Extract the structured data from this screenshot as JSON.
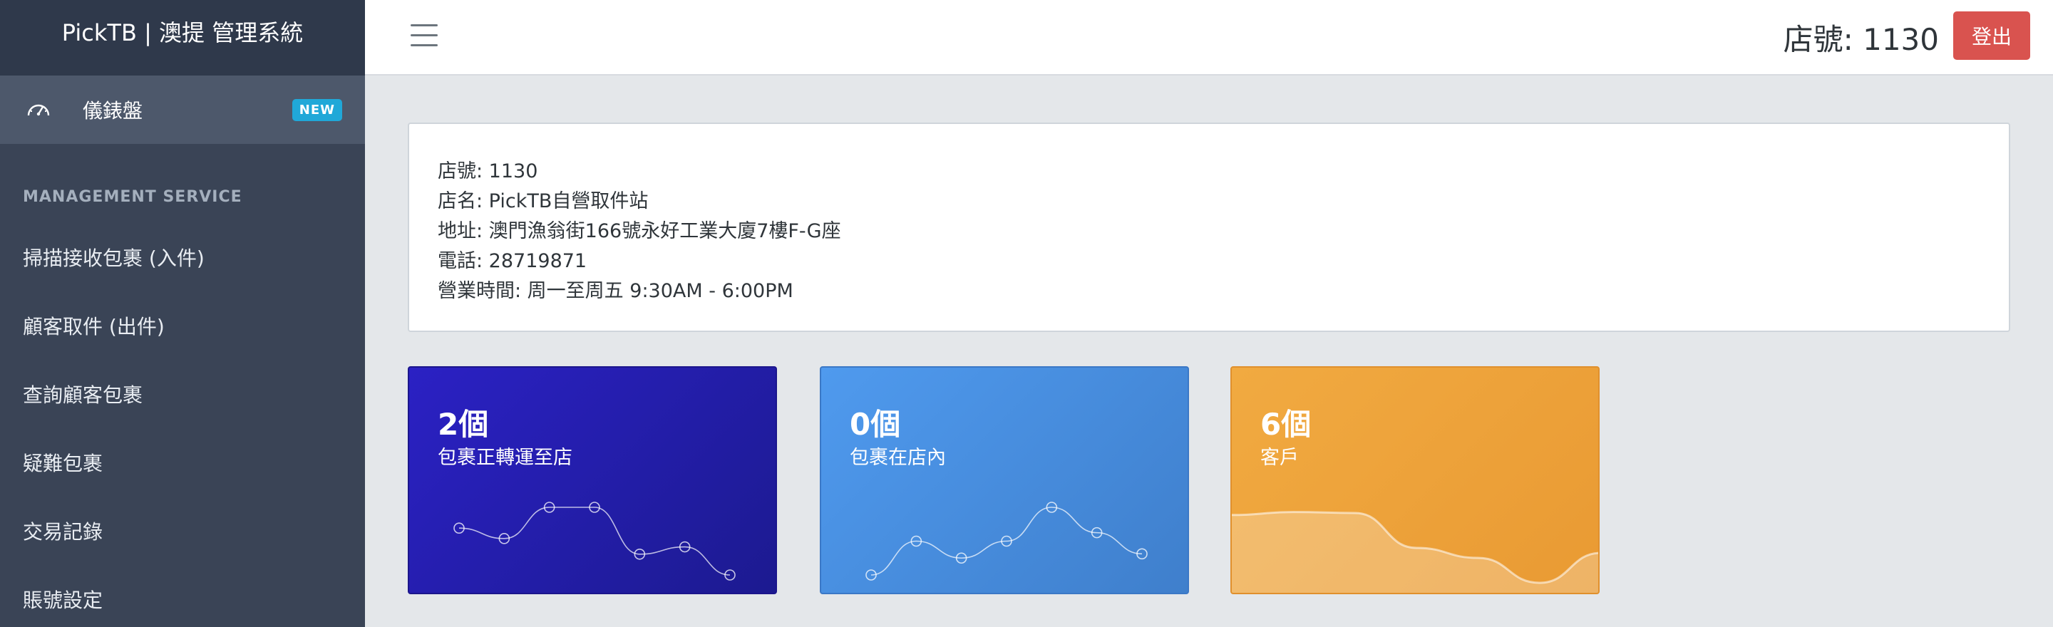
{
  "app": {
    "brand": "PickTB | 澳提 管理系統"
  },
  "sidebar": {
    "dashboard": {
      "label": "儀錶盤",
      "badge": "NEW",
      "icon": "speedometer-icon"
    },
    "section_title": "MANAGEMENT SERVICE",
    "items": [
      {
        "label": "掃描接收包裹 (入件)"
      },
      {
        "label": "顧客取件 (出件)"
      },
      {
        "label": "查詢顧客包裹"
      },
      {
        "label": "疑難包裹"
      },
      {
        "label": "交易記錄"
      },
      {
        "label": "賬號設定"
      }
    ]
  },
  "header": {
    "menu_icon": "hamburger-icon",
    "shop_number": "店號: 1130",
    "logout_label": "登出"
  },
  "info": {
    "lines": [
      "店號: 1130",
      "店名: PickTB自營取件站",
      "地址: 澳門漁翁街166號永好工業大廈7樓F-G座",
      "電話: 28719871",
      "營業時間: 周一至周五 9:30AM - 6:00PM"
    ]
  },
  "stats": [
    {
      "value": "2個",
      "caption": "包裹正轉運至店",
      "color": "#2b21c4",
      "sparkline": [
        40,
        30,
        60,
        60,
        15,
        22,
        -5
      ]
    },
    {
      "value": "0個",
      "caption": "包裹在店內",
      "color": "#4f9aee",
      "sparkline": [
        0,
        40,
        20,
        40,
        80,
        50,
        25
      ]
    },
    {
      "value": "6個",
      "caption": "客戶",
      "color": "#f1aa41",
      "sparkline": [
        78,
        81,
        80,
        45,
        35,
        10,
        40
      ]
    }
  ]
}
